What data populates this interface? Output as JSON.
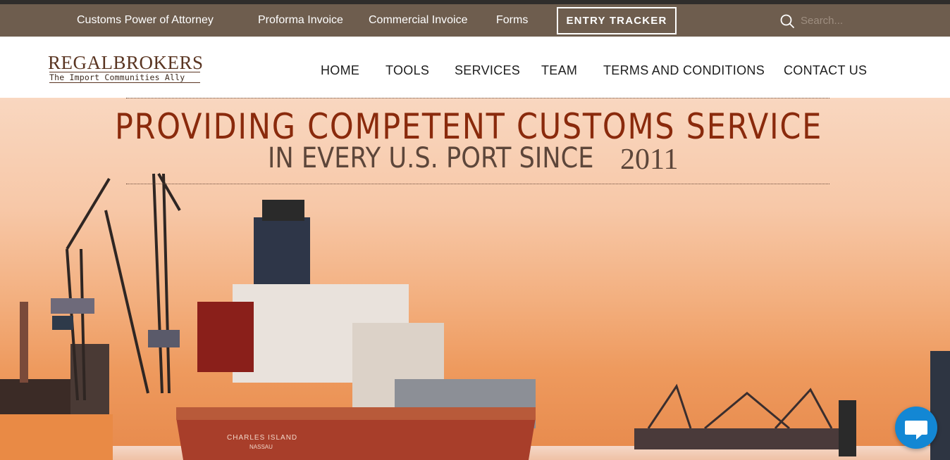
{
  "utility_bar": {
    "links": [
      "Customs Power of Attorney",
      "Proforma Invoice",
      "Commercial Invoice",
      "Forms"
    ],
    "entry_tracker": "ENTRY TRACKER",
    "search_placeholder": "Search..."
  },
  "brand": {
    "name": "REGALBROKERS",
    "tagline": "The Import Communities Ally"
  },
  "nav": [
    "HOME",
    "TOOLS",
    "SERVICES",
    "TEAM",
    "TERMS AND CONDITIONS",
    "CONTACT US"
  ],
  "hero": {
    "title": "PROVIDING COMPETENT CUSTOMS SERVICE",
    "subtitle": "IN EVERY U.S. PORT SINCE",
    "year": "2011",
    "ship_name": "CHARLES ISLAND",
    "ship_port": "NASSAU"
  },
  "colors": {
    "utility_bg": "#6e5d4e",
    "title": "#8a2a0c",
    "chat": "#1387d4"
  },
  "icons": [
    "search-icon",
    "chat-icon"
  ]
}
